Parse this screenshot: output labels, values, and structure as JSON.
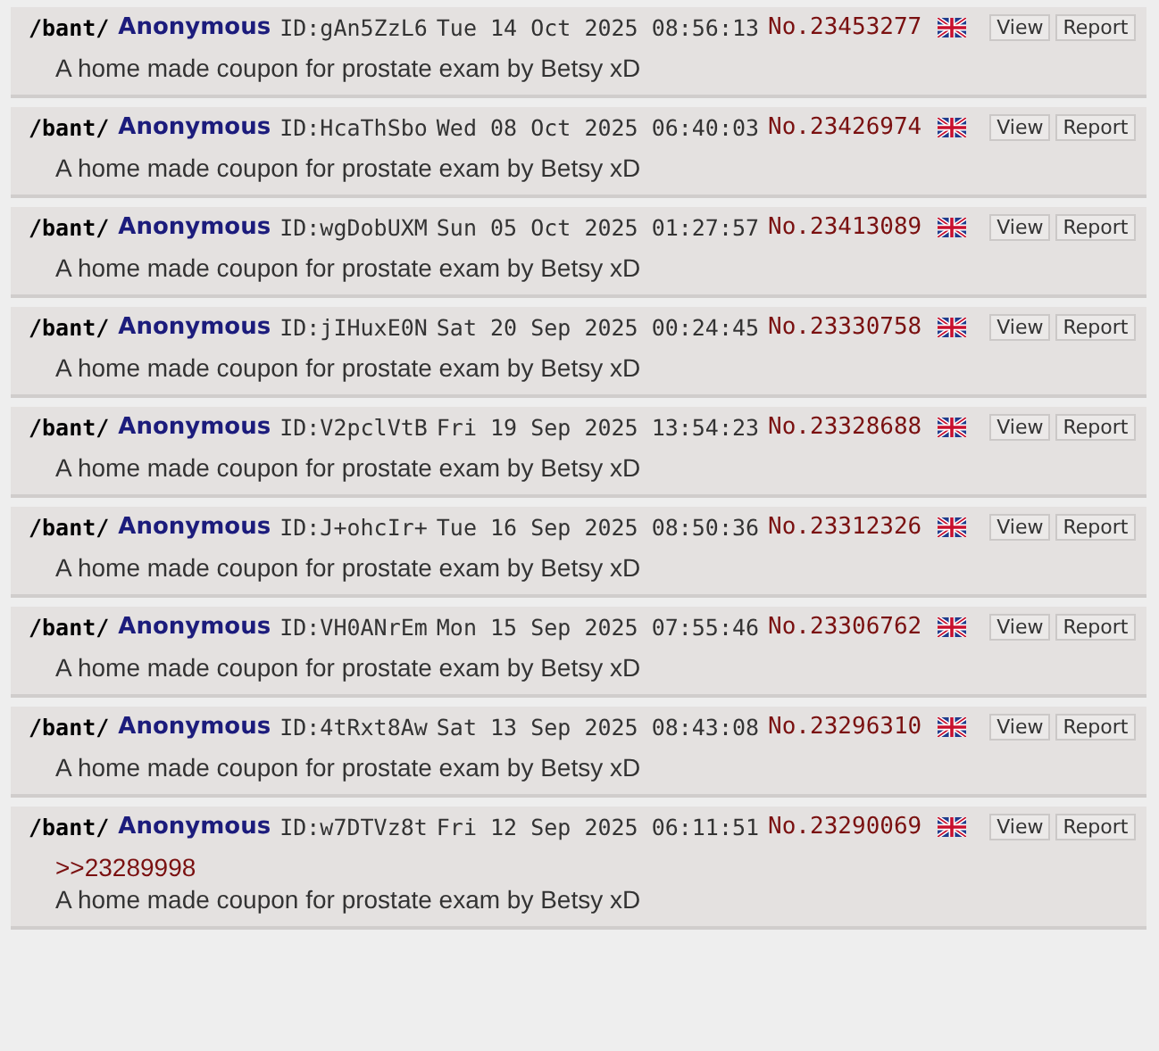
{
  "posts": [
    {
      "board": "/bant/",
      "name": "Anonymous",
      "id": "ID:gAn5ZzL6",
      "datetime": "Tue 14 Oct 2025 08:56:13",
      "number": "No.23453277",
      "buttons": [
        "View",
        "Report"
      ],
      "comment": "A home made coupon for prostate exam by Betsy xD"
    },
    {
      "board": "/bant/",
      "name": "Anonymous",
      "id": "ID:HcaThSbo",
      "datetime": "Wed 08 Oct 2025 06:40:03",
      "number": "No.23426974",
      "buttons": [
        "View",
        "Report"
      ],
      "comment": "A home made coupon for prostate exam by Betsy xD"
    },
    {
      "board": "/bant/",
      "name": "Anonymous",
      "id": "ID:wgDobUXM",
      "datetime": "Sun 05 Oct 2025 01:27:57",
      "number": "No.23413089",
      "buttons": [
        "View",
        "Report"
      ],
      "comment": "A home made coupon for prostate exam by Betsy xD"
    },
    {
      "board": "/bant/",
      "name": "Anonymous",
      "id": "ID:jIHuxE0N",
      "datetime": "Sat 20 Sep 2025 00:24:45",
      "number": "No.23330758",
      "buttons": [
        "View",
        "Report"
      ],
      "comment": "A home made coupon for prostate exam by Betsy xD"
    },
    {
      "board": "/bant/",
      "name": "Anonymous",
      "id": "ID:V2pclVtB",
      "datetime": "Fri 19 Sep 2025 13:54:23",
      "number": "No.23328688",
      "buttons": [
        "View",
        "Report"
      ],
      "comment": "A home made coupon for prostate exam by Betsy xD"
    },
    {
      "board": "/bant/",
      "name": "Anonymous",
      "id": "ID:J+ohcIr+",
      "datetime": "Tue 16 Sep 2025 08:50:36",
      "number": "No.23312326",
      "buttons": [
        "View",
        "Report"
      ],
      "comment": "A home made coupon for prostate exam by Betsy xD"
    },
    {
      "board": "/bant/",
      "name": "Anonymous",
      "id": "ID:VH0ANrEm",
      "datetime": "Mon 15 Sep 2025 07:55:46",
      "number": "No.23306762",
      "buttons": [
        "View",
        "Report"
      ],
      "comment": "A home made coupon for prostate exam by Betsy xD"
    },
    {
      "board": "/bant/",
      "name": "Anonymous",
      "id": "ID:4tRxt8Aw",
      "datetime": "Sat 13 Sep 2025 08:43:08",
      "number": "No.23296310",
      "buttons": [
        "View",
        "Report"
      ],
      "comment": "A home made coupon for prostate exam by Betsy xD"
    },
    {
      "board": "/bant/",
      "name": "Anonymous",
      "id": "ID:w7DTVz8t",
      "datetime": "Fri 12 Sep 2025 06:11:51",
      "number": "No.23290069",
      "buttons": [
        "View",
        "Report"
      ],
      "quote": ">>23289998",
      "comment": "A home made coupon for prostate exam by Betsy xD"
    }
  ]
}
